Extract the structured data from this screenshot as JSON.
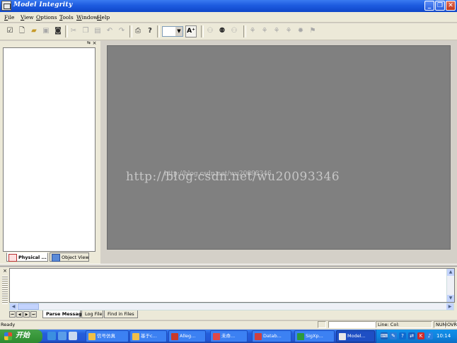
{
  "window": {
    "title": "Model Integrity"
  },
  "menu": [
    "File",
    "View",
    "Options",
    "Tools",
    "Window",
    "Help"
  ],
  "toolbar": {
    "buttons": [
      "check-icon",
      "new-file-icon",
      "open-folder-icon",
      "save-icon",
      "save-all-icon",
      "cut-icon",
      "copy-icon",
      "paste-icon",
      "undo-icon",
      "redo-icon",
      "print-icon",
      "help-icon",
      "binoculars-icon",
      "find-next-icon",
      "find-all-icon",
      "run-icon",
      "step-icon",
      "check-sel-icon",
      "check-all-icon",
      "stop-icon",
      "report-icon"
    ],
    "zoom_value": "",
    "font_grow_label": "A"
  },
  "left_pane": {
    "tabs": [
      "Physical ...",
      "Object View"
    ]
  },
  "main": {
    "watermark": "http://blog.csdn.net/wu20093346",
    "watermark_small": "http://blog.csdn.net/wu20093346"
  },
  "output": {
    "tabs": [
      "Parse Messages",
      "Log File",
      "Find in Files"
    ]
  },
  "status": {
    "text": "Ready",
    "position": "Line: Col:",
    "num": "NUM",
    "ovr": "OVR"
  },
  "taskbar": {
    "start_label": "开始",
    "tasks": [
      {
        "label": "信号仿真",
        "color": "#f0c048"
      },
      {
        "label": "基于c...",
        "color": "#f0c048"
      },
      {
        "label": "Alleg...",
        "color": "#c83a2a"
      },
      {
        "label": "未命...",
        "color": "#e04848"
      },
      {
        "label": "Datab...",
        "color": "#d04040"
      },
      {
        "label": "SigXp...",
        "color": "#2c9a3c"
      },
      {
        "label": "Model...",
        "color": "#e8e8e8"
      }
    ],
    "clock": "10:14"
  }
}
